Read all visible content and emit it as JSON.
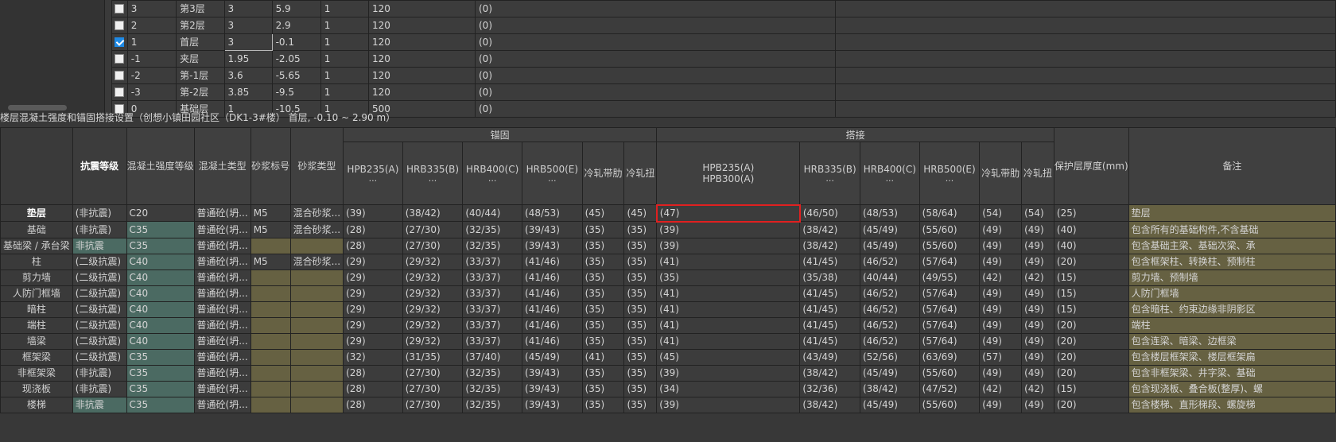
{
  "floor_list": {
    "rows": [
      {
        "checked": false,
        "code": "3",
        "name": "第3层",
        "height": "3",
        "elevation": "5.9",
        "count": "1",
        "slab": "120",
        "extra": "(0)"
      },
      {
        "checked": false,
        "code": "2",
        "name": "第2层",
        "height": "3",
        "elevation": "2.9",
        "count": "1",
        "slab": "120",
        "extra": "(0)"
      },
      {
        "checked": true,
        "code": "1",
        "name": "首层",
        "height": "3",
        "elevation": "-0.1",
        "count": "1",
        "slab": "120",
        "extra": "(0)"
      },
      {
        "checked": false,
        "code": "-1",
        "name": "夹层",
        "height": "1.95",
        "elevation": "-2.05",
        "count": "1",
        "slab": "120",
        "extra": "(0)"
      },
      {
        "checked": false,
        "code": "-2",
        "name": "第-1层",
        "height": "3.6",
        "elevation": "-5.65",
        "count": "1",
        "slab": "120",
        "extra": "(0)"
      },
      {
        "checked": false,
        "code": "-3",
        "name": "第-2层",
        "height": "3.85",
        "elevation": "-9.5",
        "count": "1",
        "slab": "120",
        "extra": "(0)"
      },
      {
        "checked": false,
        "code": "0",
        "name": "基础层",
        "height": "1",
        "elevation": "-10.5",
        "count": "1",
        "slab": "500",
        "extra": "(0)"
      }
    ]
  },
  "section_title": "楼层混凝土强度和锚固搭接设置（创想小镇田园社区（DK1-3#楼） 首层, -0.10 ~ 2.90 m）",
  "settings": {
    "group_anchor": "锚固",
    "group_lap": "搭接",
    "headers": {
      "seismic": "抗震等级",
      "concrete_grade": "混凝土强度等级",
      "concrete_type": "混凝土类型",
      "mortar_grade": "砂浆标号",
      "mortar_type": "砂浆类型",
      "a_hpb": "HPB235(A)",
      "a_hrb335": "HRB335(B)",
      "a_hrb400": "HRB400(C)",
      "a_hrb500": "HRB500(E)",
      "a_crb": "冷轧带肋",
      "a_ctb": "冷轧扭",
      "l_hpb1": "HPB235(A)",
      "l_hpb2": "HPB300(A)",
      "l_hrb335": "HRB335(B)",
      "l_hrb400": "HRB400(C)",
      "l_hrb500": "HRB500(E)",
      "l_crb": "冷轧带肋",
      "l_ctb": "冷轧扭",
      "cover": "保护层厚度(mm)",
      "remark": "备注",
      "ellipsis": "..."
    },
    "rows": [
      {
        "name": "垫层",
        "seismic": "(非抗震)",
        "grade": "C20",
        "ctype": "普通砼(坍...",
        "mgrade": "M5",
        "mtype": "混合砂浆...",
        "a1": "(39)",
        "a2": "(38/42)",
        "a3": "(40/44)",
        "a4": "(48/53)",
        "a5": "(45)",
        "a6": "(45)",
        "l1": "(47)",
        "l2": "(46/50)",
        "l3": "(48/53)",
        "l4": "(58/64)",
        "l5": "(54)",
        "l6": "(54)",
        "cover": "(25)",
        "remark": "垫层"
      },
      {
        "name": "基础",
        "seismic": "(非抗震)",
        "grade": "C35",
        "ctype": "普通砼(坍...",
        "mgrade": "M5",
        "mtype": "混合砂浆...",
        "a1": "(28)",
        "a2": "(27/30)",
        "a3": "(32/35)",
        "a4": "(39/43)",
        "a5": "(35)",
        "a6": "(35)",
        "l1": "(39)",
        "l2": "(38/42)",
        "l3": "(45/49)",
        "l4": "(55/60)",
        "l5": "(49)",
        "l6": "(49)",
        "cover": "(40)",
        "remark": "包含所有的基础构件,不含基础"
      },
      {
        "name": "基础梁 / 承台梁",
        "seismic": "非抗震",
        "grade": "C35",
        "ctype": "普通砼(坍...",
        "mgrade": "",
        "mtype": "",
        "a1": "(28)",
        "a2": "(27/30)",
        "a3": "(32/35)",
        "a4": "(39/43)",
        "a5": "(35)",
        "a6": "(35)",
        "l1": "(39)",
        "l2": "(38/42)",
        "l3": "(45/49)",
        "l4": "(55/60)",
        "l5": "(49)",
        "l6": "(49)",
        "cover": "(40)",
        "remark": "包含基础主梁、基础次梁、承"
      },
      {
        "name": "柱",
        "seismic": "(二级抗震)",
        "grade": "C40",
        "ctype": "普通砼(坍...",
        "mgrade": "M5",
        "mtype": "混合砂浆...",
        "a1": "(29)",
        "a2": "(29/32)",
        "a3": "(33/37)",
        "a4": "(41/46)",
        "a5": "(35)",
        "a6": "(35)",
        "l1": "(41)",
        "l2": "(41/45)",
        "l3": "(46/52)",
        "l4": "(57/64)",
        "l5": "(49)",
        "l6": "(49)",
        "cover": "(20)",
        "remark": "包含框架柱、转换柱、预制柱"
      },
      {
        "name": "剪力墙",
        "seismic": "(二级抗震)",
        "grade": "C40",
        "ctype": "普通砼(坍...",
        "mgrade": "",
        "mtype": "",
        "a1": "(29)",
        "a2": "(29/32)",
        "a3": "(33/37)",
        "a4": "(41/46)",
        "a5": "(35)",
        "a6": "(35)",
        "l1": "(35)",
        "l2": "(35/38)",
        "l3": "(40/44)",
        "l4": "(49/55)",
        "l5": "(42)",
        "l6": "(42)",
        "cover": "(15)",
        "remark": "剪力墙、预制墙"
      },
      {
        "name": "人防门框墙",
        "seismic": "(二级抗震)",
        "grade": "C40",
        "ctype": "普通砼(坍...",
        "mgrade": "",
        "mtype": "",
        "a1": "(29)",
        "a2": "(29/32)",
        "a3": "(33/37)",
        "a4": "(41/46)",
        "a5": "(35)",
        "a6": "(35)",
        "l1": "(41)",
        "l2": "(41/45)",
        "l3": "(46/52)",
        "l4": "(57/64)",
        "l5": "(49)",
        "l6": "(49)",
        "cover": "(15)",
        "remark": "人防门框墙"
      },
      {
        "name": "暗柱",
        "seismic": "(二级抗震)",
        "grade": "C40",
        "ctype": "普通砼(坍...",
        "mgrade": "",
        "mtype": "",
        "a1": "(29)",
        "a2": "(29/32)",
        "a3": "(33/37)",
        "a4": "(41/46)",
        "a5": "(35)",
        "a6": "(35)",
        "l1": "(41)",
        "l2": "(41/45)",
        "l3": "(46/52)",
        "l4": "(57/64)",
        "l5": "(49)",
        "l6": "(49)",
        "cover": "(15)",
        "remark": "包含暗柱、约束边缘非阴影区"
      },
      {
        "name": "端柱",
        "seismic": "(二级抗震)",
        "grade": "C40",
        "ctype": "普通砼(坍...",
        "mgrade": "",
        "mtype": "",
        "a1": "(29)",
        "a2": "(29/32)",
        "a3": "(33/37)",
        "a4": "(41/46)",
        "a5": "(35)",
        "a6": "(35)",
        "l1": "(41)",
        "l2": "(41/45)",
        "l3": "(46/52)",
        "l4": "(57/64)",
        "l5": "(49)",
        "l6": "(49)",
        "cover": "(20)",
        "remark": "端柱"
      },
      {
        "name": "墙梁",
        "seismic": "(二级抗震)",
        "grade": "C40",
        "ctype": "普通砼(坍...",
        "mgrade": "",
        "mtype": "",
        "a1": "(29)",
        "a2": "(29/32)",
        "a3": "(33/37)",
        "a4": "(41/46)",
        "a5": "(35)",
        "a6": "(35)",
        "l1": "(41)",
        "l2": "(41/45)",
        "l3": "(46/52)",
        "l4": "(57/64)",
        "l5": "(49)",
        "l6": "(49)",
        "cover": "(20)",
        "remark": "包含连梁、暗梁、边框梁"
      },
      {
        "name": "框架梁",
        "seismic": "(二级抗震)",
        "grade": "C35",
        "ctype": "普通砼(坍...",
        "mgrade": "",
        "mtype": "",
        "a1": "(32)",
        "a2": "(31/35)",
        "a3": "(37/40)",
        "a4": "(45/49)",
        "a5": "(41)",
        "a6": "(35)",
        "l1": "(45)",
        "l2": "(43/49)",
        "l3": "(52/56)",
        "l4": "(63/69)",
        "l5": "(57)",
        "l6": "(49)",
        "cover": "(20)",
        "remark": "包含楼层框架梁、楼层框架扁"
      },
      {
        "name": "非框架梁",
        "seismic": "(非抗震)",
        "grade": "C35",
        "ctype": "普通砼(坍...",
        "mgrade": "",
        "mtype": "",
        "a1": "(28)",
        "a2": "(27/30)",
        "a3": "(32/35)",
        "a4": "(39/43)",
        "a5": "(35)",
        "a6": "(35)",
        "l1": "(39)",
        "l2": "(38/42)",
        "l3": "(45/49)",
        "l4": "(55/60)",
        "l5": "(49)",
        "l6": "(49)",
        "cover": "(20)",
        "remark": "包含非框架梁、井字梁、基础"
      },
      {
        "name": "现浇板",
        "seismic": "(非抗震)",
        "grade": "C35",
        "ctype": "普通砼(坍...",
        "mgrade": "",
        "mtype": "",
        "a1": "(28)",
        "a2": "(27/30)",
        "a3": "(32/35)",
        "a4": "(39/43)",
        "a5": "(35)",
        "a6": "(35)",
        "l1": "(34)",
        "l2": "(32/36)",
        "l3": "(38/42)",
        "l4": "(47/52)",
        "l5": "(42)",
        "l6": "(42)",
        "cover": "(15)",
        "remark": "包含现浇板、叠合板(整厚)、螺"
      },
      {
        "name": "楼梯",
        "seismic": "非抗震",
        "grade": "C35",
        "ctype": "普通砼(坍...",
        "mgrade": "",
        "mtype": "",
        "a1": "(28)",
        "a2": "(27/30)",
        "a3": "(32/35)",
        "a4": "(39/43)",
        "a5": "(35)",
        "a6": "(35)",
        "l1": "(39)",
        "l2": "(38/42)",
        "l3": "(45/49)",
        "l4": "(55/60)",
        "l5": "(49)",
        "l6": "(49)",
        "cover": "(20)",
        "remark": "包含楼梯、直形梯段、螺旋梯"
      }
    ]
  },
  "colors": {
    "teal": "#4b6a62",
    "olive": "#666142",
    "selection": "#e02020",
    "checkbox": "#1e8ae6"
  }
}
